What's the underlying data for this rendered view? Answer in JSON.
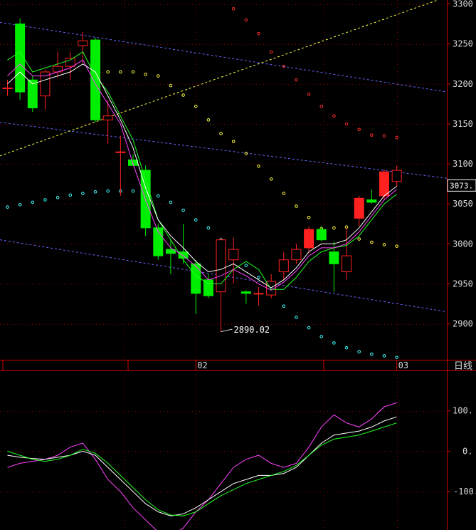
{
  "chart_data": [
    {
      "type": "candlestick",
      "title": "",
      "y_ticks": [
        "3300",
        "3250",
        "3200",
        "3150",
        "3100",
        "3050",
        "3000",
        "2950",
        "2900"
      ],
      "ylim": [
        2855,
        3305
      ],
      "x_ticks": [
        {
          "label": "02",
          "index": 15
        },
        {
          "label": "03",
          "index": 31
        }
      ],
      "period_label": "日线",
      "current_price_label": "3073.",
      "current_price": 3073,
      "low_annotation": {
        "label": "2890.02",
        "index": 17,
        "value": 2890.02
      },
      "colors": {
        "up": "#ff2020",
        "down": "#00ee00",
        "axis": "#cc0000",
        "grid": "#800000"
      },
      "candles": [
        {
          "o": 3195,
          "h": 3205,
          "l": 3185,
          "c": 3195
        },
        {
          "o": 3275,
          "h": 3282,
          "l": 3180,
          "c": 3190
        },
        {
          "o": 3205,
          "h": 3210,
          "l": 3165,
          "c": 3170
        },
        {
          "o": 3185,
          "h": 3218,
          "l": 3168,
          "c": 3215
        },
        {
          "o": 3215,
          "h": 3240,
          "l": 3208,
          "c": 3222
        },
        {
          "o": 3222,
          "h": 3240,
          "l": 3205,
          "c": 3232
        },
        {
          "o": 3248,
          "h": 3265,
          "l": 3226,
          "c": 3254
        },
        {
          "o": 3255,
          "h": 3258,
          "l": 3152,
          "c": 3155
        },
        {
          "o": 3155,
          "h": 3180,
          "l": 3125,
          "c": 3160
        },
        {
          "o": 3115,
          "h": 3135,
          "l": 3060,
          "c": 3115
        },
        {
          "o": 3105,
          "h": 3112,
          "l": 3100,
          "c": 3098
        },
        {
          "o": 3092,
          "h": 3098,
          "l": 3010,
          "c": 3020
        },
        {
          "o": 3020,
          "h": 3025,
          "l": 2980,
          "c": 2985
        },
        {
          "o": 2993,
          "h": 3005,
          "l": 2962,
          "c": 2988
        },
        {
          "o": 2990,
          "h": 3025,
          "l": 2975,
          "c": 2982
        },
        {
          "o": 2975,
          "h": 2980,
          "l": 2912,
          "c": 2938
        },
        {
          "o": 2955,
          "h": 2962,
          "l": 2932,
          "c": 2935
        },
        {
          "o": 2940,
          "h": 3008,
          "l": 2890.02,
          "c": 3005
        },
        {
          "o": 2980,
          "h": 3008,
          "l": 2950,
          "c": 2993
        },
        {
          "o": 2940,
          "h": 2942,
          "l": 2925,
          "c": 2938
        },
        {
          "o": 2938,
          "h": 2946,
          "l": 2923,
          "c": 2938
        },
        {
          "o": 2936,
          "h": 2962,
          "l": 2932,
          "c": 2953
        },
        {
          "o": 2965,
          "h": 2990,
          "l": 2955,
          "c": 2980
        },
        {
          "o": 2980,
          "h": 3000,
          "l": 2975,
          "c": 2993
        },
        {
          "o": 2995,
          "h": 3022,
          "l": 2988,
          "c": 3018
        },
        {
          "o": 3018,
          "h": 3022,
          "l": 3003,
          "c": 3005
        },
        {
          "o": 2990,
          "h": 3003,
          "l": 2940,
          "c": 2975
        },
        {
          "o": 2965,
          "h": 3020,
          "l": 2955,
          "c": 2985
        },
        {
          "o": 3032,
          "h": 3060,
          "l": 3022,
          "c": 3057
        },
        {
          "o": 3055,
          "h": 3068,
          "l": 3050,
          "c": 3052
        },
        {
          "o": 3060,
          "h": 3093,
          "l": 3055,
          "c": 3090
        },
        {
          "o": 3078,
          "h": 3098,
          "l": 3072,
          "c": 3092
        }
      ],
      "ma_short": [
        3200,
        3215,
        3200,
        3205,
        3210,
        3215,
        3225,
        3215,
        3185,
        3155,
        3120,
        3070,
        3030,
        3010,
        2995,
        2978,
        2965,
        2968,
        2975,
        2965,
        2955,
        2945,
        2955,
        2970,
        2990,
        3000,
        3000,
        3005,
        3020,
        3040,
        3060,
        3072
      ],
      "ma_long": [
        3230,
        3240,
        3215,
        3220,
        3225,
        3230,
        3240,
        3210,
        3190,
        3160,
        3130,
        3080,
        3030,
        3005,
        2980,
        2960,
        2950,
        2950,
        2968,
        2978,
        2968,
        2943,
        2943,
        2958,
        2978,
        2990,
        2995,
        2998,
        3010,
        3030,
        3050,
        3062
      ],
      "ma_mid": [
        3210,
        3225,
        3210,
        3210,
        3215,
        3220,
        3230,
        3200,
        3175,
        3150,
        3100,
        3055,
        3015,
        2995,
        2985,
        2972,
        2955,
        2960,
        2968,
        2960,
        2950,
        2942,
        2952,
        2966,
        2985,
        2995,
        2995,
        3000,
        3015,
        3035,
        3055,
        3068
      ],
      "channel_lines": [
        {
          "from_value": 3277,
          "to_value": 3190,
          "color": "#6666ff"
        },
        {
          "from_value": 3152,
          "to_value": 3082,
          "color": "#6666ff"
        },
        {
          "from_value": 3005,
          "to_value": 2915,
          "color": "#6666ff"
        },
        {
          "from_value": 3110,
          "to_value": 3309,
          "color": "#ffff44"
        }
      ],
      "sar_upper": [
        {
          "i": 18,
          "v": 3294
        },
        {
          "i": 19,
          "v": 3280
        },
        {
          "i": 20,
          "v": 3263
        },
        {
          "i": 21,
          "v": 3240
        },
        {
          "i": 22,
          "v": 3222
        },
        {
          "i": 23,
          "v": 3205
        },
        {
          "i": 24,
          "v": 3187
        },
        {
          "i": 25,
          "v": 3172
        },
        {
          "i": 26,
          "v": 3160
        },
        {
          "i": 27,
          "v": 3150
        },
        {
          "i": 28,
          "v": 3143
        },
        {
          "i": 29,
          "v": 3136
        },
        {
          "i": 30,
          "v": 3135
        },
        {
          "i": 31,
          "v": 3133
        }
      ],
      "sar_yellow": [
        {
          "i": 8,
          "v": 3215
        },
        {
          "i": 9,
          "v": 3215
        },
        {
          "i": 10,
          "v": 3215
        },
        {
          "i": 11,
          "v": 3212
        },
        {
          "i": 12,
          "v": 3210
        },
        {
          "i": 13,
          "v": 3198
        },
        {
          "i": 14,
          "v": 3186
        },
        {
          "i": 15,
          "v": 3172
        },
        {
          "i": 16,
          "v": 3155
        },
        {
          "i": 17,
          "v": 3138
        },
        {
          "i": 18,
          "v": 3128
        },
        {
          "i": 19,
          "v": 3113
        },
        {
          "i": 20,
          "v": 3097
        },
        {
          "i": 21,
          "v": 3081
        },
        {
          "i": 22,
          "v": 3063
        },
        {
          "i": 23,
          "v": 3047
        },
        {
          "i": 24,
          "v": 3033
        },
        {
          "i": 25,
          "v": 3019
        },
        {
          "i": 26,
          "v": 3020
        },
        {
          "i": 27,
          "v": 3021
        },
        {
          "i": 28,
          "v": 3006
        },
        {
          "i": 29,
          "v": 3002
        },
        {
          "i": 30,
          "v": 2999
        },
        {
          "i": 31,
          "v": 2997
        }
      ],
      "sar_cyan": [
        {
          "i": 0,
          "v": 3046
        },
        {
          "i": 1,
          "v": 3049
        },
        {
          "i": 2,
          "v": 3052
        },
        {
          "i": 3,
          "v": 3055
        },
        {
          "i": 4,
          "v": 3058
        },
        {
          "i": 5,
          "v": 3061
        },
        {
          "i": 6,
          "v": 3063
        },
        {
          "i": 7,
          "v": 3065
        },
        {
          "i": 8,
          "v": 3066
        },
        {
          "i": 9,
          "v": 3066
        },
        {
          "i": 10,
          "v": 3066
        },
        {
          "i": 11,
          "v": 3066
        },
        {
          "i": 12,
          "v": 3060
        },
        {
          "i": 13,
          "v": 3052
        },
        {
          "i": 14,
          "v": 3042
        },
        {
          "i": 15,
          "v": 3030
        },
        {
          "i": 16,
          "v": 3020
        },
        {
          "i": 17,
          "v": 3005
        },
        {
          "i": 18,
          "v": 2989
        },
        {
          "i": 19,
          "v": 2973
        },
        {
          "i": 20,
          "v": 2958
        },
        {
          "i": 21,
          "v": 2940
        },
        {
          "i": 22,
          "v": 2922
        },
        {
          "i": 23,
          "v": 2908
        },
        {
          "i": 24,
          "v": 2895
        },
        {
          "i": 25,
          "v": 2884
        },
        {
          "i": 26,
          "v": 2876
        },
        {
          "i": 27,
          "v": 2870
        },
        {
          "i": 28,
          "v": 2865
        },
        {
          "i": 29,
          "v": 2862
        },
        {
          "i": 30,
          "v": 2860
        },
        {
          "i": 31,
          "v": 2858
        }
      ]
    },
    {
      "type": "line",
      "title": "",
      "y_ticks": [
        "100.",
        "0.",
        "-100."
      ],
      "tick_values": [
        100,
        0,
        -100
      ],
      "ylim": [
        -195,
        200
      ],
      "series": [
        {
          "color": "#ff44ff",
          "values": [
            -40,
            -30,
            -25,
            -20,
            -10,
            10,
            20,
            -20,
            -70,
            -100,
            -140,
            -170,
            -200,
            -210,
            -190,
            -150,
            -120,
            -80,
            -40,
            -20,
            -10,
            -30,
            -40,
            -30,
            10,
            60,
            90,
            70,
            60,
            80,
            110,
            120
          ]
        },
        {
          "color": "#ffffff",
          "values": [
            -10,
            -15,
            -18,
            -20,
            -15,
            -10,
            0,
            -10,
            -40,
            -70,
            -100,
            -130,
            -150,
            -160,
            -155,
            -140,
            -120,
            -100,
            -80,
            -70,
            -60,
            -60,
            -55,
            -40,
            -10,
            20,
            40,
            45,
            50,
            60,
            75,
            85
          ]
        },
        {
          "color": "#22ff22",
          "values": [
            0,
            -10,
            -20,
            -25,
            -20,
            -10,
            5,
            -5,
            -30,
            -60,
            -90,
            -120,
            -145,
            -158,
            -160,
            -150,
            -130,
            -110,
            -95,
            -80,
            -70,
            -60,
            -50,
            -35,
            -10,
            15,
            30,
            35,
            40,
            50,
            60,
            70
          ]
        }
      ]
    }
  ]
}
